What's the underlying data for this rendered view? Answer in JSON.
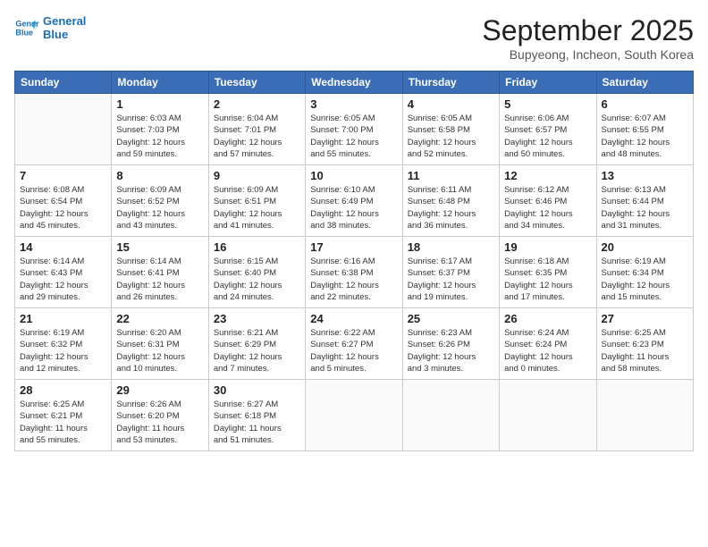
{
  "header": {
    "logo_line1": "General",
    "logo_line2": "Blue",
    "main_title": "September 2025",
    "sub_title": "Bupyeong, Incheon, South Korea"
  },
  "weekdays": [
    "Sunday",
    "Monday",
    "Tuesday",
    "Wednesday",
    "Thursday",
    "Friday",
    "Saturday"
  ],
  "weeks": [
    [
      {
        "day": "",
        "info": ""
      },
      {
        "day": "1",
        "info": "Sunrise: 6:03 AM\nSunset: 7:03 PM\nDaylight: 12 hours\nand 59 minutes."
      },
      {
        "day": "2",
        "info": "Sunrise: 6:04 AM\nSunset: 7:01 PM\nDaylight: 12 hours\nand 57 minutes."
      },
      {
        "day": "3",
        "info": "Sunrise: 6:05 AM\nSunset: 7:00 PM\nDaylight: 12 hours\nand 55 minutes."
      },
      {
        "day": "4",
        "info": "Sunrise: 6:05 AM\nSunset: 6:58 PM\nDaylight: 12 hours\nand 52 minutes."
      },
      {
        "day": "5",
        "info": "Sunrise: 6:06 AM\nSunset: 6:57 PM\nDaylight: 12 hours\nand 50 minutes."
      },
      {
        "day": "6",
        "info": "Sunrise: 6:07 AM\nSunset: 6:55 PM\nDaylight: 12 hours\nand 48 minutes."
      }
    ],
    [
      {
        "day": "7",
        "info": "Sunrise: 6:08 AM\nSunset: 6:54 PM\nDaylight: 12 hours\nand 45 minutes."
      },
      {
        "day": "8",
        "info": "Sunrise: 6:09 AM\nSunset: 6:52 PM\nDaylight: 12 hours\nand 43 minutes."
      },
      {
        "day": "9",
        "info": "Sunrise: 6:09 AM\nSunset: 6:51 PM\nDaylight: 12 hours\nand 41 minutes."
      },
      {
        "day": "10",
        "info": "Sunrise: 6:10 AM\nSunset: 6:49 PM\nDaylight: 12 hours\nand 38 minutes."
      },
      {
        "day": "11",
        "info": "Sunrise: 6:11 AM\nSunset: 6:48 PM\nDaylight: 12 hours\nand 36 minutes."
      },
      {
        "day": "12",
        "info": "Sunrise: 6:12 AM\nSunset: 6:46 PM\nDaylight: 12 hours\nand 34 minutes."
      },
      {
        "day": "13",
        "info": "Sunrise: 6:13 AM\nSunset: 6:44 PM\nDaylight: 12 hours\nand 31 minutes."
      }
    ],
    [
      {
        "day": "14",
        "info": "Sunrise: 6:14 AM\nSunset: 6:43 PM\nDaylight: 12 hours\nand 29 minutes."
      },
      {
        "day": "15",
        "info": "Sunrise: 6:14 AM\nSunset: 6:41 PM\nDaylight: 12 hours\nand 26 minutes."
      },
      {
        "day": "16",
        "info": "Sunrise: 6:15 AM\nSunset: 6:40 PM\nDaylight: 12 hours\nand 24 minutes."
      },
      {
        "day": "17",
        "info": "Sunrise: 6:16 AM\nSunset: 6:38 PM\nDaylight: 12 hours\nand 22 minutes."
      },
      {
        "day": "18",
        "info": "Sunrise: 6:17 AM\nSunset: 6:37 PM\nDaylight: 12 hours\nand 19 minutes."
      },
      {
        "day": "19",
        "info": "Sunrise: 6:18 AM\nSunset: 6:35 PM\nDaylight: 12 hours\nand 17 minutes."
      },
      {
        "day": "20",
        "info": "Sunrise: 6:19 AM\nSunset: 6:34 PM\nDaylight: 12 hours\nand 15 minutes."
      }
    ],
    [
      {
        "day": "21",
        "info": "Sunrise: 6:19 AM\nSunset: 6:32 PM\nDaylight: 12 hours\nand 12 minutes."
      },
      {
        "day": "22",
        "info": "Sunrise: 6:20 AM\nSunset: 6:31 PM\nDaylight: 12 hours\nand 10 minutes."
      },
      {
        "day": "23",
        "info": "Sunrise: 6:21 AM\nSunset: 6:29 PM\nDaylight: 12 hours\nand 7 minutes."
      },
      {
        "day": "24",
        "info": "Sunrise: 6:22 AM\nSunset: 6:27 PM\nDaylight: 12 hours\nand 5 minutes."
      },
      {
        "day": "25",
        "info": "Sunrise: 6:23 AM\nSunset: 6:26 PM\nDaylight: 12 hours\nand 3 minutes."
      },
      {
        "day": "26",
        "info": "Sunrise: 6:24 AM\nSunset: 6:24 PM\nDaylight: 12 hours\nand 0 minutes."
      },
      {
        "day": "27",
        "info": "Sunrise: 6:25 AM\nSunset: 6:23 PM\nDaylight: 11 hours\nand 58 minutes."
      }
    ],
    [
      {
        "day": "28",
        "info": "Sunrise: 6:25 AM\nSunset: 6:21 PM\nDaylight: 11 hours\nand 55 minutes."
      },
      {
        "day": "29",
        "info": "Sunrise: 6:26 AM\nSunset: 6:20 PM\nDaylight: 11 hours\nand 53 minutes."
      },
      {
        "day": "30",
        "info": "Sunrise: 6:27 AM\nSunset: 6:18 PM\nDaylight: 11 hours\nand 51 minutes."
      },
      {
        "day": "",
        "info": ""
      },
      {
        "day": "",
        "info": ""
      },
      {
        "day": "",
        "info": ""
      },
      {
        "day": "",
        "info": ""
      }
    ]
  ]
}
